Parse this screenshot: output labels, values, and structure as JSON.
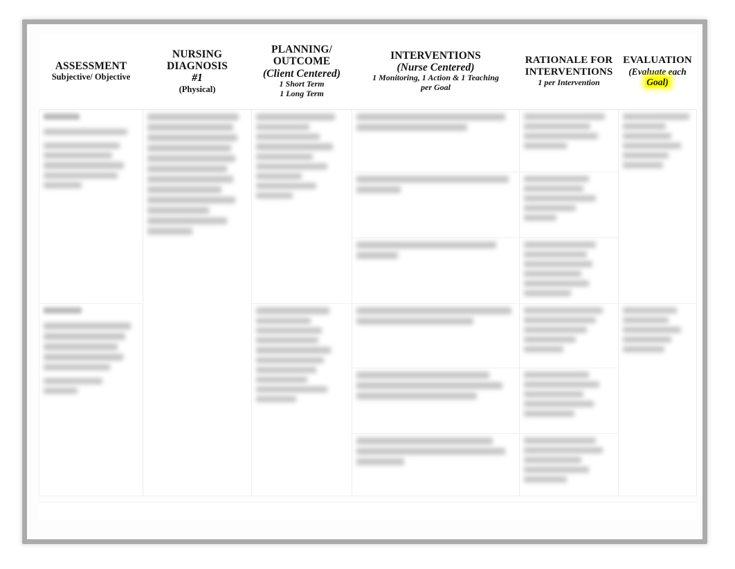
{
  "document": {
    "type": "nursing-care-plan-table",
    "frame_color": "#ababab",
    "highlight_color": "#ffff00"
  },
  "table": {
    "columns": [
      {
        "key": "assessment",
        "title": "ASSESSMENT",
        "subtitle": "Subjective/ Objective"
      },
      {
        "key": "diagnosis",
        "title_line1": "NURSING",
        "title_line2": "DIAGNOSIS",
        "number": "#1",
        "subtitle": "(Physical)"
      },
      {
        "key": "planning",
        "title_line1": "PLANNING/",
        "title_line2": "OUTCOME",
        "subtitle": "(Client Centered)",
        "note_line1": "1 Short Term",
        "note_line2": "1 Long Term"
      },
      {
        "key": "interventions",
        "title": "INTERVENTIONS",
        "subtitle": "(Nurse Centered)",
        "note_line1": "1 Monitoring, 1 Action & 1 Teaching",
        "note_line2": "per Goal"
      },
      {
        "key": "rationale",
        "title_line1": "RATIONALE FOR",
        "title_line2": "INTERVENTIONS",
        "subtitle": "1 per Intervention"
      },
      {
        "key": "evaluation",
        "title": "EVALUATION",
        "subtitle_line1": "(Evaluate each",
        "subtitle_highlight": "Goal)"
      }
    ],
    "body": {
      "note": "All body cell content is blurred/redacted in the source screenshot; no legible text is present.",
      "goal_groups": [
        {
          "assessment_lines": [
            3,
            88,
            80,
            72,
            85,
            78,
            40
          ],
          "diagnosis_lines": [
            92,
            86,
            90,
            84,
            88,
            80,
            86,
            74,
            88,
            62,
            80,
            45
          ],
          "planning_lines": [
            86,
            58,
            70,
            84,
            62,
            78,
            50,
            66,
            40
          ],
          "sub_rows": [
            {
              "interventions_lines": [
                94,
                70
              ],
              "rationale_lines": [
                90,
                74,
                82,
                48
              ]
            },
            {
              "interventions_lines": [
                96,
                28
              ],
              "rationale_lines": [
                72,
                66,
                80,
                58,
                36
              ]
            },
            {
              "interventions_lines": [
                88,
                26
              ],
              "rationale_lines": [
                80,
                70,
                76,
                64,
                72,
                52
              ]
            }
          ],
          "evaluation_lines": [
            96,
            62,
            70,
            84,
            66,
            58
          ]
        },
        {
          "assessment_lines": [
            40,
            92,
            86,
            78,
            84,
            70,
            62,
            36
          ],
          "diagnosis_lines": [],
          "planning_lines": [
            80,
            60,
            72,
            68,
            82,
            74,
            66,
            56,
            78,
            44
          ],
          "sub_rows": [
            {
              "interventions_lines": [
                98,
                74
              ],
              "rationale_lines": [
                88,
                80,
                70,
                58,
                44
              ]
            },
            {
              "interventions_lines": [
                84,
                92,
                76
              ],
              "rationale_lines": [
                72,
                84,
                66,
                78,
                56
              ]
            },
            {
              "interventions_lines": [
                86,
                94,
                30
              ],
              "rationale_lines": [
                80,
                88,
                64,
                72,
                48
              ]
            }
          ],
          "evaluation_lines": [
            78,
            66,
            84,
            70,
            60
          ]
        }
      ]
    }
  }
}
